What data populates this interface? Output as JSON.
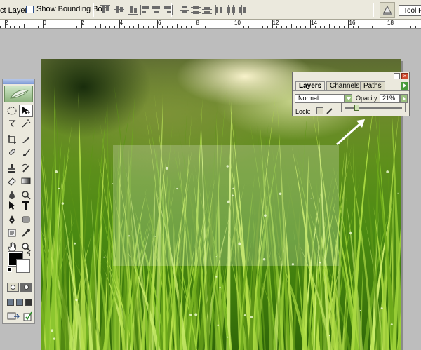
{
  "options_bar": {
    "auto_select_label": "ct Layer",
    "show_bounding_box_label": "Show Bounding Box",
    "tool_presets_label": "Tool P"
  },
  "ruler": {
    "labels": [
      "2",
      "0",
      "2",
      "4",
      "6",
      "8",
      "10",
      "12",
      "14",
      "16",
      "18"
    ]
  },
  "layers_panel": {
    "tabs": [
      "Layers",
      "Channels",
      "Paths"
    ],
    "active_tab": "Layers",
    "blend_mode": "Normal",
    "opacity_label": "Opacity:",
    "opacity_value": "21%",
    "opacity_fraction": 0.21,
    "lock_label": "Lock:"
  },
  "overlay": {
    "opacity": 0.21
  },
  "colors": {
    "ui_background": "#ebe9dd",
    "workspace": "#bdbdbd",
    "accent_green": "#9ac07f",
    "close_button": "#d04a2e",
    "foreground_color": "#000000",
    "background_color": "#ffffff"
  },
  "toolbox": {
    "tools": [
      "marquee-tool-icon",
      "move-tool-icon",
      "lasso-tool-icon",
      "magic-wand-icon",
      "crop-tool-icon",
      "slice-tool-icon",
      "healing-brush-icon",
      "brush-tool-icon",
      "clone-stamp-icon",
      "history-brush-icon",
      "eraser-icon",
      "gradient-tool-icon",
      "blur-tool-icon",
      "dodge-tool-icon",
      "path-selection-icon",
      "type-tool-icon",
      "pen-tool-icon",
      "shape-tool-icon",
      "notes-tool-icon",
      "eyedropper-icon",
      "hand-tool-icon",
      "zoom-tool-icon"
    ]
  }
}
